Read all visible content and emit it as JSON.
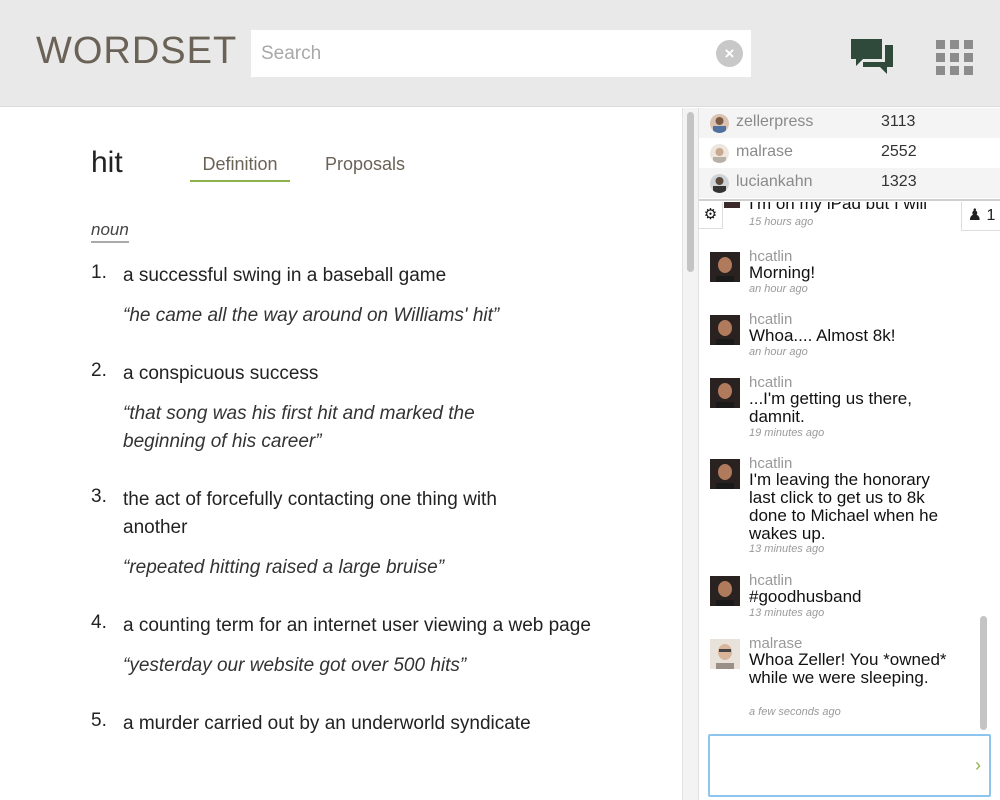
{
  "header": {
    "logo": "WORDSET",
    "search_placeholder": "Search",
    "search_value": "",
    "clear_icon": "×"
  },
  "entry": {
    "word": "hit",
    "tabs": [
      {
        "label": "Definition",
        "active": true
      },
      {
        "label": "Proposals",
        "active": false
      }
    ],
    "part_of_speech": "noun",
    "definitions": [
      {
        "num": "1.",
        "text": "a successful swing in a baseball game",
        "example": "“he came all the way around on Williams' hit”"
      },
      {
        "num": "2.",
        "text": "a conspicuous success",
        "example": "“that song was his first hit and marked the beginning of his career”"
      },
      {
        "num": "3.",
        "text": "the act of forcefully contacting one thing with another",
        "example": "“repeated hitting raised a large bruise”"
      },
      {
        "num": "4.",
        "text": "a counting term for an internet user viewing a web page",
        "example": "“yesterday our website got over 500 hits”"
      },
      {
        "num": "5.",
        "text": "a murder carried out by an underworld syndicate",
        "example": ""
      }
    ]
  },
  "leaderboard": [
    {
      "name": "zellerpress",
      "score": "3113"
    },
    {
      "name": "malrase",
      "score": "2552"
    },
    {
      "name": "luciankahn",
      "score": "1323"
    }
  ],
  "chat": {
    "online_count": "1",
    "partial": {
      "text": "I'm on my iPad but I will",
      "time": "15 hours ago"
    },
    "messages": [
      {
        "user": "hcatlin",
        "text": "Morning!",
        "time": "an hour ago"
      },
      {
        "user": "hcatlin",
        "text": "Whoa.... Almost 8k!",
        "time": "an hour ago"
      },
      {
        "user": "hcatlin",
        "text": "...I'm getting us there, damnit.",
        "time": "19 minutes ago"
      },
      {
        "user": "hcatlin",
        "text": "I'm leaving the honorary last click to get us to 8k done to Michael when he wakes up.",
        "time": "13 minutes ago"
      },
      {
        "user": "hcatlin",
        "text": "#goodhusband",
        "time": "13 minutes ago"
      },
      {
        "user": "malrase",
        "text": "Whoa Zeller! You *owned* while we were sleeping.",
        "time": "a few seconds ago"
      }
    ],
    "input_value": "",
    "send_icon": "›"
  },
  "colors": {
    "accent_green": "#8bb34a",
    "header_bg": "#e9e9e9",
    "logo_brown": "#6b6257",
    "icon_green": "#2f4a3a",
    "icon_grey": "#8c8c8c",
    "input_focus": "#8ec5ef"
  }
}
